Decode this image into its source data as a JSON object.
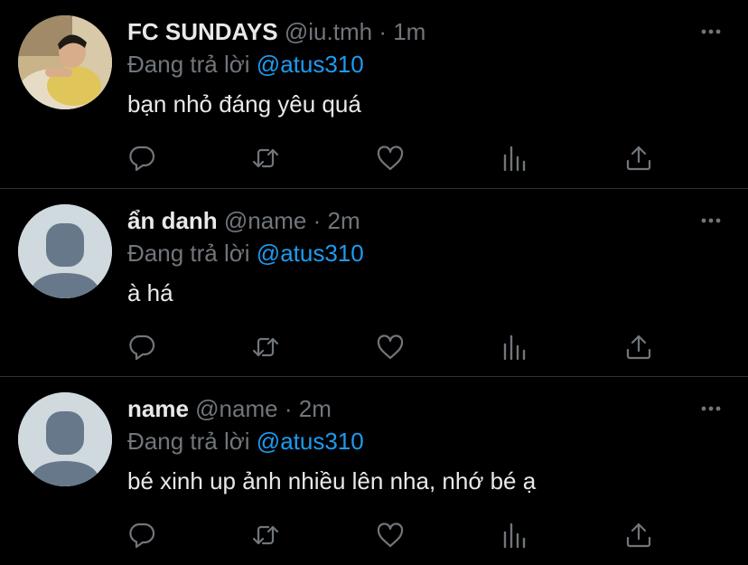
{
  "colors": {
    "background": "#000000",
    "text": "#e7e9ea",
    "muted": "#71767b",
    "accent": "#1d9bf0",
    "divider": "#2f3336",
    "default_avatar_bg": "#cfd9de",
    "default_avatar_fg": "#67788a"
  },
  "replies": [
    {
      "name": "FC SUNDAYS",
      "handle": "@iu.tmh",
      "separator": "·",
      "time": "1m",
      "replying_prefix": "Đang trả lời",
      "mention": "@atus310",
      "text": "bạn nhỏ đáng yêu quá",
      "avatar": "photo"
    },
    {
      "name": "ẩn danh",
      "handle": "@name",
      "separator": "·",
      "time": "2m",
      "replying_prefix": "Đang trả lời",
      "mention": "@atus310",
      "text": "à há",
      "avatar": "default-person"
    },
    {
      "name": "name",
      "handle": "@name",
      "separator": "·",
      "time": "2m",
      "replying_prefix": "Đang trả lời",
      "mention": "@atus310",
      "text": "bé xinh up ảnh nhiều lên nha, nhớ bé ạ",
      "avatar": "default-person"
    }
  ],
  "icons": [
    "more-icon",
    "reply-icon",
    "retweet-icon",
    "like-icon",
    "stats-icon",
    "share-icon"
  ]
}
